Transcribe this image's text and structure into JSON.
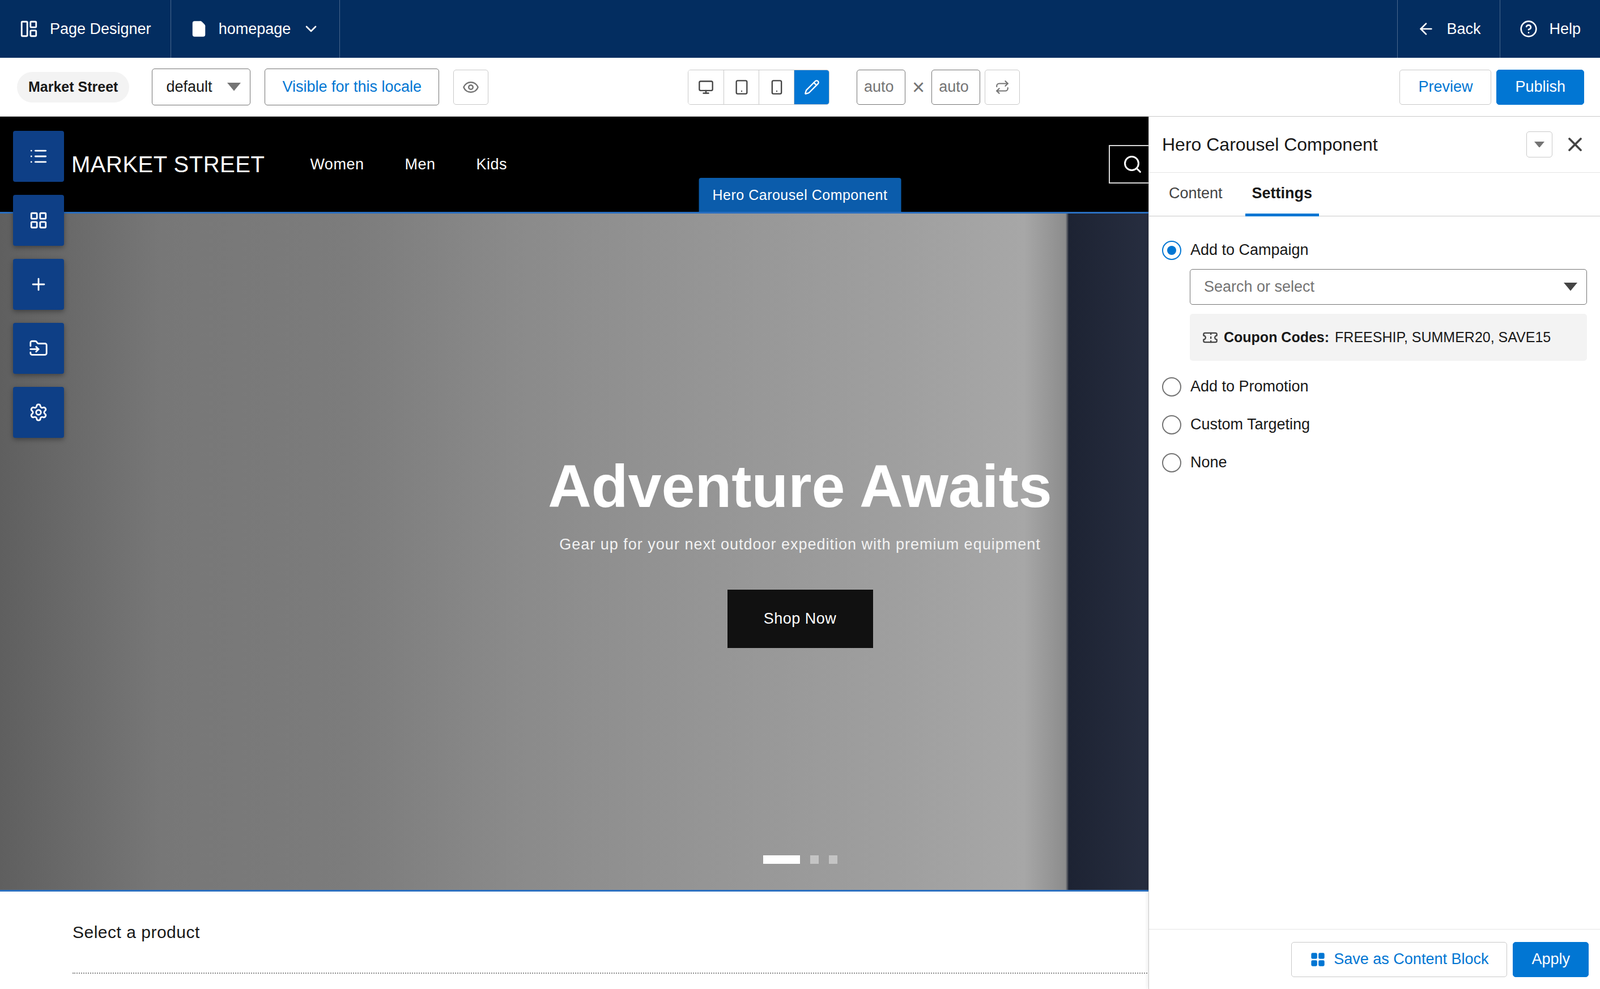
{
  "app_bar": {
    "title": "Page Designer",
    "page": "homepage",
    "back": "Back",
    "help": "Help"
  },
  "toolbar": {
    "site": "Market Street",
    "locale": "default",
    "visibility": "Visible for this locale",
    "devices": [
      {
        "selected": false
      },
      {
        "selected": false
      },
      {
        "selected": false
      },
      {
        "selected": true
      }
    ],
    "width": "auto",
    "times": "×",
    "height": "auto",
    "preview": "Preview",
    "publish": "Publish"
  },
  "canvas": {
    "logo": "MARKET STREET",
    "nav": [
      "Women",
      "Men",
      "Kids"
    ],
    "component_label": "Hero Carousel Component",
    "hero": {
      "title": "Adventure Awaits",
      "subtitle": "Gear up for your next outdoor expedition with premium equipment",
      "cta": "Shop Now",
      "slides": [
        {
          "selected": true
        },
        {
          "selected": false
        },
        {
          "selected": false
        }
      ]
    },
    "next_section": "Select a product"
  },
  "panel": {
    "title": "Hero Carousel Component",
    "tabs": [
      {
        "label": "Content",
        "selected": false
      },
      {
        "label": "Settings",
        "selected": true
      }
    ],
    "targeting": [
      {
        "label": "Add to Campaign",
        "selected": true
      },
      {
        "label": "Add to Promotion",
        "selected": false
      },
      {
        "label": "Custom Targeting",
        "selected": false
      },
      {
        "label": "None",
        "selected": false
      }
    ],
    "campaign_search": {
      "placeholder": "Search or select"
    },
    "coupons": {
      "label": "Coupon Codes:",
      "value": "FREESHIP, SUMMER20, SAVE15"
    },
    "buttons": {
      "save_block": "Save as Content Block",
      "apply": "Apply"
    }
  }
}
